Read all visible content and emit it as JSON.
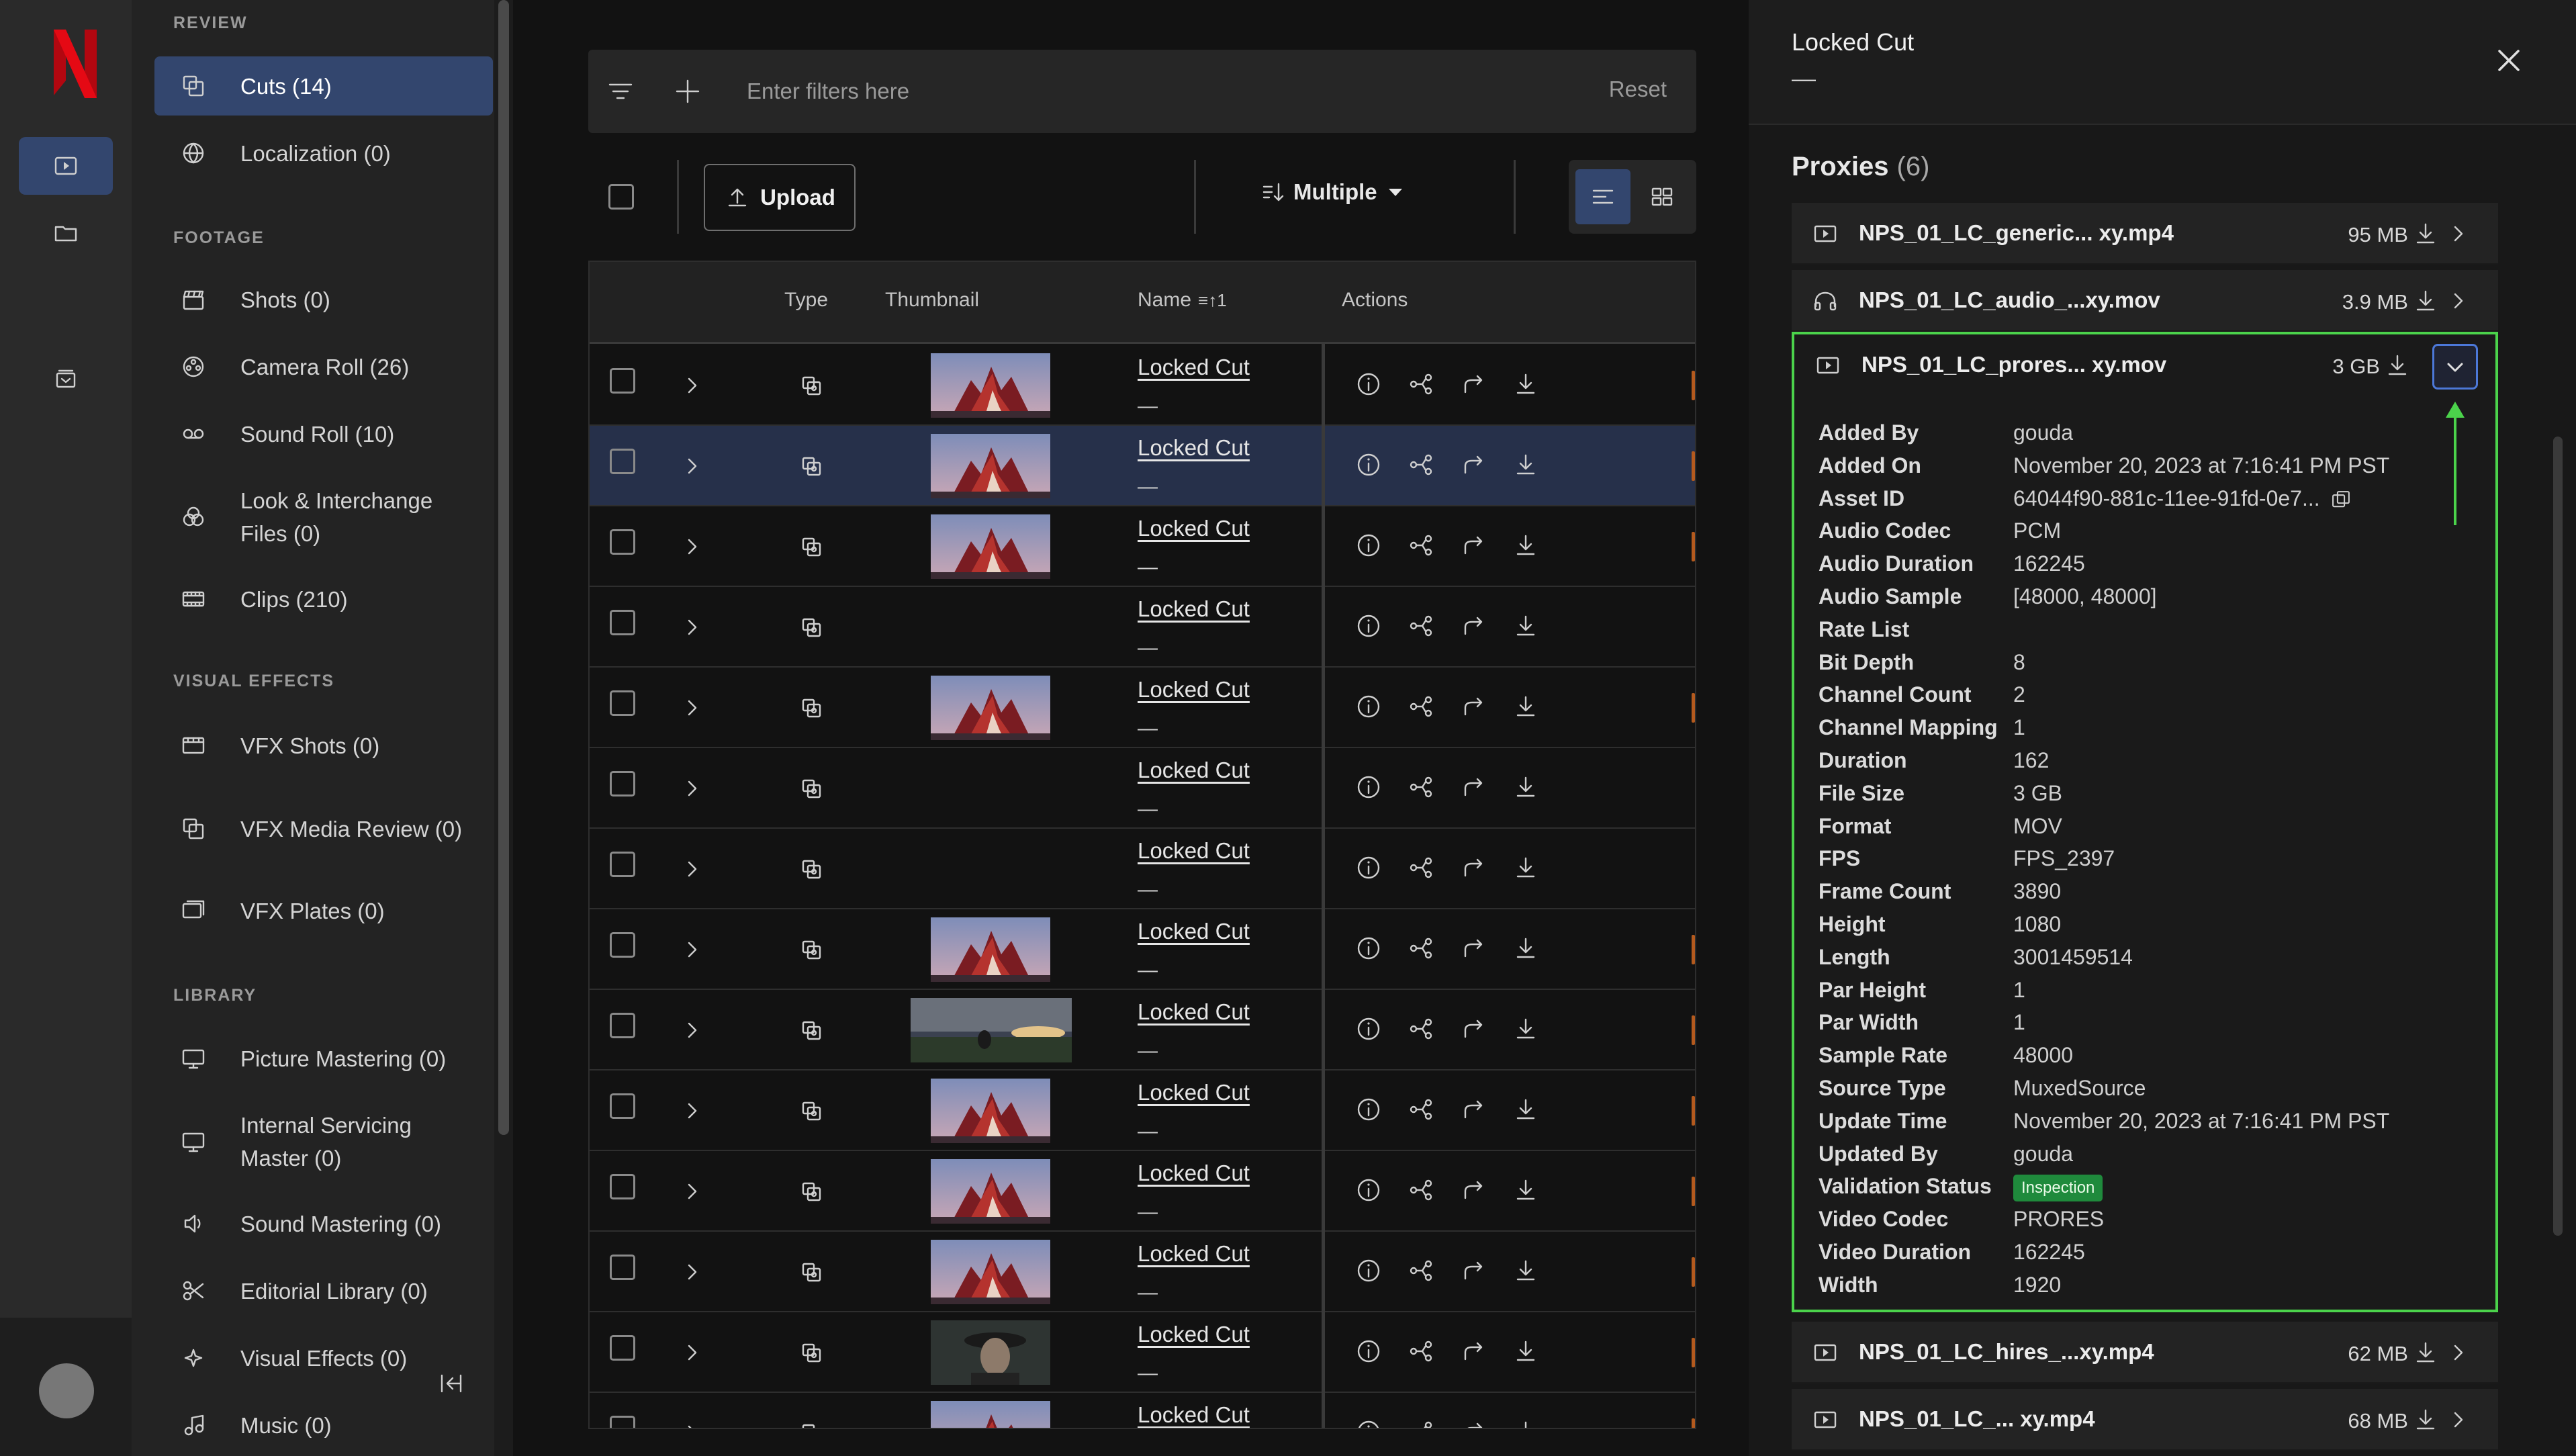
{
  "brand": {
    "logo_letter": "N",
    "logo_color": "#e50914"
  },
  "nav": {
    "sections": [
      {
        "id": "review",
        "title": "REVIEW"
      },
      {
        "id": "footage",
        "title": "FOOTAGE"
      },
      {
        "id": "visual_effects",
        "title": "VISUAL EFFECTS"
      },
      {
        "id": "library",
        "title": "LIBRARY"
      }
    ],
    "items": [
      {
        "label": "Cuts (14)",
        "icon": "stacked-squares-icon",
        "active": true
      },
      {
        "label": "Localization (0)",
        "icon": "globe-icon"
      },
      {
        "label": "Shots (0)",
        "icon": "clapperboard-icon"
      },
      {
        "label": "Camera Roll (26)",
        "icon": "film-reel-icon"
      },
      {
        "label": "Sound Roll (10)",
        "icon": "tape-icon"
      },
      {
        "label": "Look & Interchange Files (0)",
        "icon": "color-circles-icon"
      },
      {
        "label": "Clips (210)",
        "icon": "filmstrip-icon"
      },
      {
        "label": "VFX Shots (0)",
        "icon": "vfx-board-icon"
      },
      {
        "label": "VFX Media Review (0)",
        "icon": "stacked-squares-icon"
      },
      {
        "label": "VFX Plates (0)",
        "icon": "plates-icon"
      },
      {
        "label": "Picture Mastering (0)",
        "icon": "monitor-icon"
      },
      {
        "label": "Internal Servicing Master (0)",
        "icon": "monitor-icon"
      },
      {
        "label": "Sound Mastering (0)",
        "icon": "speaker-icon"
      },
      {
        "label": "Editorial Library (0)",
        "icon": "scissors-icon"
      },
      {
        "label": "Visual Effects (0)",
        "icon": "sparkle-icon"
      },
      {
        "label": "Music (0)",
        "icon": "music-note-icon"
      }
    ]
  },
  "filter": {
    "placeholder": "Enter filters here",
    "reset_label": "Reset"
  },
  "toolbar": {
    "upload_label": "Upload",
    "sort_label": "Multiple"
  },
  "table": {
    "columns": {
      "type": "Type",
      "thumbnail": "Thumbnail",
      "name": "Name",
      "name_sort": "≡↑1",
      "actions": "Actions"
    },
    "rows": [
      {
        "name": "Locked Cut",
        "sub": "—",
        "thumb": "fire"
      },
      {
        "name": "Locked Cut",
        "sub": "—",
        "thumb": "fire",
        "selected": true
      },
      {
        "name": "Locked Cut",
        "sub": "—",
        "thumb": "fire"
      },
      {
        "name": "Locked Cut",
        "sub": "—",
        "thumb": "none"
      },
      {
        "name": "Locked Cut",
        "sub": "—",
        "thumb": "fire"
      },
      {
        "name": "Locked Cut",
        "sub": "—",
        "thumb": "none"
      },
      {
        "name": "Locked Cut",
        "sub": "—",
        "thumb": "none"
      },
      {
        "name": "Locked Cut",
        "sub": "—",
        "thumb": "fire"
      },
      {
        "name": "Locked Cut",
        "sub": "—",
        "thumb": "landscape"
      },
      {
        "name": "Locked Cut",
        "sub": "—",
        "thumb": "fire"
      },
      {
        "name": "Locked Cut",
        "sub": "—",
        "thumb": "fire"
      },
      {
        "name": "Locked Cut",
        "sub": "—",
        "thumb": "fire"
      },
      {
        "name": "Locked Cut",
        "sub": "—",
        "thumb": "portrait"
      },
      {
        "name": "Locked Cut",
        "sub": "—",
        "thumb": "fire"
      }
    ]
  },
  "panel": {
    "title": "Locked Cut",
    "subtitle": "—",
    "proxies_title": "Proxies",
    "proxies_count": "(6)",
    "proxies": [
      {
        "name": "NPS_01_LC_generic...  xy.mp4",
        "size": "95 MB",
        "icon": "video-icon"
      },
      {
        "name": "NPS_01_LC_audio_...xy.mov",
        "size": "3.9 MB",
        "icon": "headphones-icon"
      },
      {
        "name": "NPS_01_LC_prores...  xy.mov",
        "size": "3 GB",
        "icon": "video-icon",
        "expanded": true
      },
      {
        "name": "NPS_01_LC_hires_...xy.mp4",
        "size": "62 MB",
        "icon": "video-icon"
      },
      {
        "name": "NPS_01_LC_...  xy.mp4",
        "size": "68 MB",
        "icon": "video-icon"
      }
    ],
    "metadata": [
      {
        "key": "Added By",
        "value": "gouda"
      },
      {
        "key": "Added On",
        "value": "November 20, 2023 at 7:16:41 PM PST"
      },
      {
        "key": "Asset ID",
        "value": "64044f90-881c-11ee-91fd-0e7...",
        "copy": true
      },
      {
        "key": "Audio Codec",
        "value": "PCM"
      },
      {
        "key": "Audio Duration",
        "value": "162245"
      },
      {
        "key": "Audio Sample Rate List",
        "value": "[48000, 48000]"
      },
      {
        "key": "Bit Depth",
        "value": "8"
      },
      {
        "key": "Channel Count",
        "value": "2"
      },
      {
        "key": "Channel Mapping",
        "value": "1"
      },
      {
        "key": "Duration",
        "value": "162"
      },
      {
        "key": "File Size",
        "value": "3 GB"
      },
      {
        "key": "Format",
        "value": "MOV"
      },
      {
        "key": "FPS",
        "value": "FPS_2397"
      },
      {
        "key": "Frame Count",
        "value": "3890"
      },
      {
        "key": "Height",
        "value": "1080"
      },
      {
        "key": "Length",
        "value": "3001459514"
      },
      {
        "key": "Par Height",
        "value": "1"
      },
      {
        "key": "Par Width",
        "value": "1"
      },
      {
        "key": "Sample Rate",
        "value": "48000"
      },
      {
        "key": "Source Type",
        "value": "MuxedSource"
      },
      {
        "key": "Update Time",
        "value": "November 20, 2023 at 7:16:41 PM PST"
      },
      {
        "key": "Updated By",
        "value": "gouda"
      },
      {
        "key": "Validation Status",
        "value": "Inspection",
        "badge": true
      },
      {
        "key": "Video Codec",
        "value": "PRORES"
      },
      {
        "key": "Video Duration",
        "value": "162245"
      },
      {
        "key": "Width",
        "value": "1920"
      }
    ]
  },
  "colors": {
    "accent": "#33466e",
    "highlight": "#4bd34b",
    "badge": "#1f8a3c",
    "focus": "#4c78d8"
  }
}
